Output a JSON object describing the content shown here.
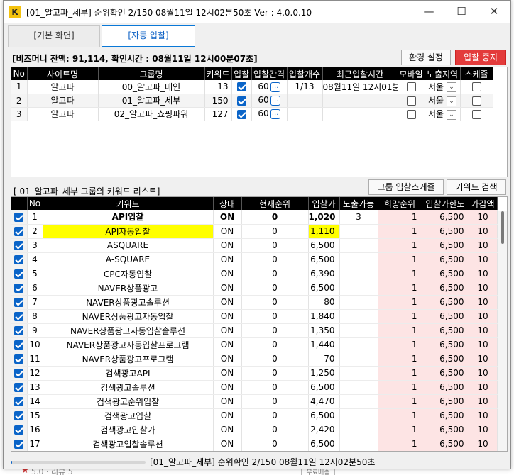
{
  "window": {
    "app_icon_letter": "K",
    "title": "[01_알고파_세부] 순위확인 2/150 08월11일 12시02분50초 Ver : 4.0.0.10",
    "minimize": "—",
    "maximize": "☐",
    "close": "✕"
  },
  "tabs": [
    {
      "label": "[기본 화면]",
      "active": false
    },
    {
      "label": "[자동 입찰]",
      "active": true
    }
  ],
  "balance": "[비즈머니 잔액: 91,114, 확인시간 : 08월11일 12시00분07초]",
  "buttons": {
    "env_settings": "환경 설정",
    "bid_stop": "입찰 중지",
    "group_schedule": "그룹 입찰스케쥴",
    "keyword_search": "키워드 검색"
  },
  "groups": {
    "headers": [
      "No",
      "사이트명",
      "그룹명",
      "키워드",
      "입찰",
      "입찰간격",
      "입찰개수",
      "최근입찰시간",
      "모바일",
      "노출지역",
      "스케쥴"
    ],
    "rows": [
      {
        "no": "1",
        "site": "알고파",
        "group": "00_알고파_메인",
        "keywords": "13",
        "bid": true,
        "interval": "60",
        "count": "1/13",
        "last_time": "08월11일 12시01분",
        "mobile": false,
        "region": "서울",
        "schedule": false
      },
      {
        "no": "2",
        "site": "알고파",
        "group": "01_알고파_세부",
        "keywords": "150",
        "bid": true,
        "interval": "60",
        "count": "",
        "last_time": "",
        "mobile": false,
        "region": "서울",
        "schedule": false
      },
      {
        "no": "3",
        "site": "알고파",
        "group": "02_알고파_쇼핑파워",
        "keywords": "127",
        "bid": true,
        "interval": "60",
        "count": "",
        "last_time": "",
        "mobile": false,
        "region": "서울",
        "schedule": false
      }
    ],
    "dots_label": "...",
    "dropdown_glyph": "⌄"
  },
  "keyword_list_label": "[ 01_알고파_세부 그룹의 키워드 리스트]",
  "keywords": {
    "headers": [
      "",
      "No",
      "키워드",
      "상태",
      "현재순위",
      "입찰가",
      "노출가능",
      "희망순위",
      "입찰가한도",
      "가감액"
    ],
    "rows": [
      {
        "no": "1",
        "kw": "API입찰",
        "state": "ON",
        "rank": "0",
        "bid": "1,020",
        "expose": "3",
        "want": "1",
        "limit": "6,500",
        "delta": "10"
      },
      {
        "no": "2",
        "kw": "API자동입찰",
        "state": "ON",
        "rank": "0",
        "bid": "1,110",
        "expose": "",
        "want": "1",
        "limit": "6,500",
        "delta": "10"
      },
      {
        "no": "3",
        "kw": "ASQUARE",
        "state": "ON",
        "rank": "0",
        "bid": "6,500",
        "expose": "",
        "want": "1",
        "limit": "6,500",
        "delta": "10"
      },
      {
        "no": "4",
        "kw": "A-SQUARE",
        "state": "ON",
        "rank": "0",
        "bid": "6,500",
        "expose": "",
        "want": "1",
        "limit": "6,500",
        "delta": "10"
      },
      {
        "no": "5",
        "kw": "CPC자동입찰",
        "state": "ON",
        "rank": "0",
        "bid": "6,390",
        "expose": "",
        "want": "1",
        "limit": "6,500",
        "delta": "10"
      },
      {
        "no": "6",
        "kw": "NAVER상품광고",
        "state": "ON",
        "rank": "0",
        "bid": "6,500",
        "expose": "",
        "want": "1",
        "limit": "6,500",
        "delta": "10"
      },
      {
        "no": "7",
        "kw": "NAVER상품광고솔루션",
        "state": "ON",
        "rank": "0",
        "bid": "80",
        "expose": "",
        "want": "1",
        "limit": "6,500",
        "delta": "10"
      },
      {
        "no": "8",
        "kw": "NAVER상품광고자동입찰",
        "state": "ON",
        "rank": "0",
        "bid": "1,840",
        "expose": "",
        "want": "1",
        "limit": "6,500",
        "delta": "10"
      },
      {
        "no": "9",
        "kw": "NAVER상품광고자동입찰솔루션",
        "state": "ON",
        "rank": "0",
        "bid": "1,350",
        "expose": "",
        "want": "1",
        "limit": "6,500",
        "delta": "10"
      },
      {
        "no": "10",
        "kw": "NAVER상품광고자동입찰프로그램",
        "state": "ON",
        "rank": "0",
        "bid": "1,440",
        "expose": "",
        "want": "1",
        "limit": "6,500",
        "delta": "10"
      },
      {
        "no": "11",
        "kw": "NAVER상품광고프로그램",
        "state": "ON",
        "rank": "0",
        "bid": "70",
        "expose": "",
        "want": "1",
        "limit": "6,500",
        "delta": "10"
      },
      {
        "no": "12",
        "kw": "검색광고API",
        "state": "ON",
        "rank": "0",
        "bid": "1,250",
        "expose": "",
        "want": "1",
        "limit": "6,500",
        "delta": "10"
      },
      {
        "no": "13",
        "kw": "검색광고솔루션",
        "state": "ON",
        "rank": "0",
        "bid": "6,500",
        "expose": "",
        "want": "1",
        "limit": "6,500",
        "delta": "10"
      },
      {
        "no": "14",
        "kw": "검색광고순위입찰",
        "state": "ON",
        "rank": "0",
        "bid": "4,470",
        "expose": "",
        "want": "1",
        "limit": "6,500",
        "delta": "10"
      },
      {
        "no": "15",
        "kw": "검색광고입찰",
        "state": "ON",
        "rank": "0",
        "bid": "6,500",
        "expose": "",
        "want": "1",
        "limit": "6,500",
        "delta": "10"
      },
      {
        "no": "16",
        "kw": "검색광고입찰가",
        "state": "ON",
        "rank": "0",
        "bid": "2,420",
        "expose": "",
        "want": "1",
        "limit": "6,500",
        "delta": "10"
      },
      {
        "no": "17",
        "kw": "검색광고입찰솔루션",
        "state": "ON",
        "rank": "0",
        "bid": "6,500",
        "expose": "",
        "want": "1",
        "limit": "6,500",
        "delta": "10"
      }
    ]
  },
  "status": {
    "text": "[01_알고파_세부] 순위확인 2/150 08월11일 12시02분50초",
    "progress": 0.013
  },
  "backdrop": {
    "rating": "5.0 · 리뷰 5",
    "tag": "무료배송"
  },
  "colors": {
    "accent": "#0a64c8",
    "stop_button": "#e33b3b",
    "highlight_row": "#ffff00",
    "pink_column": "#fde4e4",
    "app_icon": "#f4c20d"
  }
}
